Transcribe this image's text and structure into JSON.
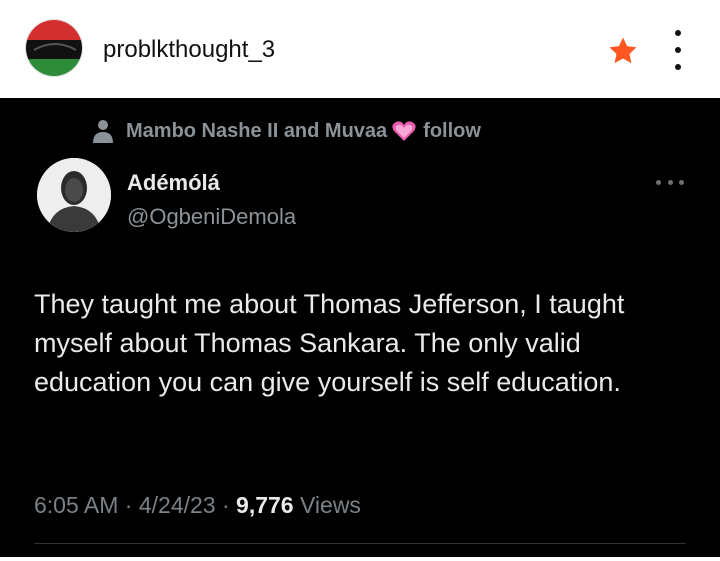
{
  "post_header": {
    "username": "problkthought_3"
  },
  "tweet": {
    "social_context": "Mambo Nashe II and Muvaa",
    "social_context_action": "follow",
    "author_name": "Adémólá",
    "author_handle": "@OgbeniDemola",
    "text": "They taught me about Thomas Jefferson, I taught myself about Thomas Sankara. The only valid education you can give yourself is self education.",
    "time": "6:05 AM",
    "separator_1": "·",
    "date": "4/24/23",
    "separator_2": "·",
    "views_count": "9,776",
    "views_label": "Views"
  },
  "colors": {
    "star": "#ff5722",
    "heart": "#e85fb0",
    "flag_red": "#d32f2f",
    "flag_green": "#2e8b3a",
    "flag_black": "#111111"
  },
  "icons": {
    "star": "star-icon",
    "more": "more-vertical-icon",
    "person": "person-icon",
    "heart": "sparkling-heart-icon",
    "tweet_more": "more-horizontal-icon"
  }
}
